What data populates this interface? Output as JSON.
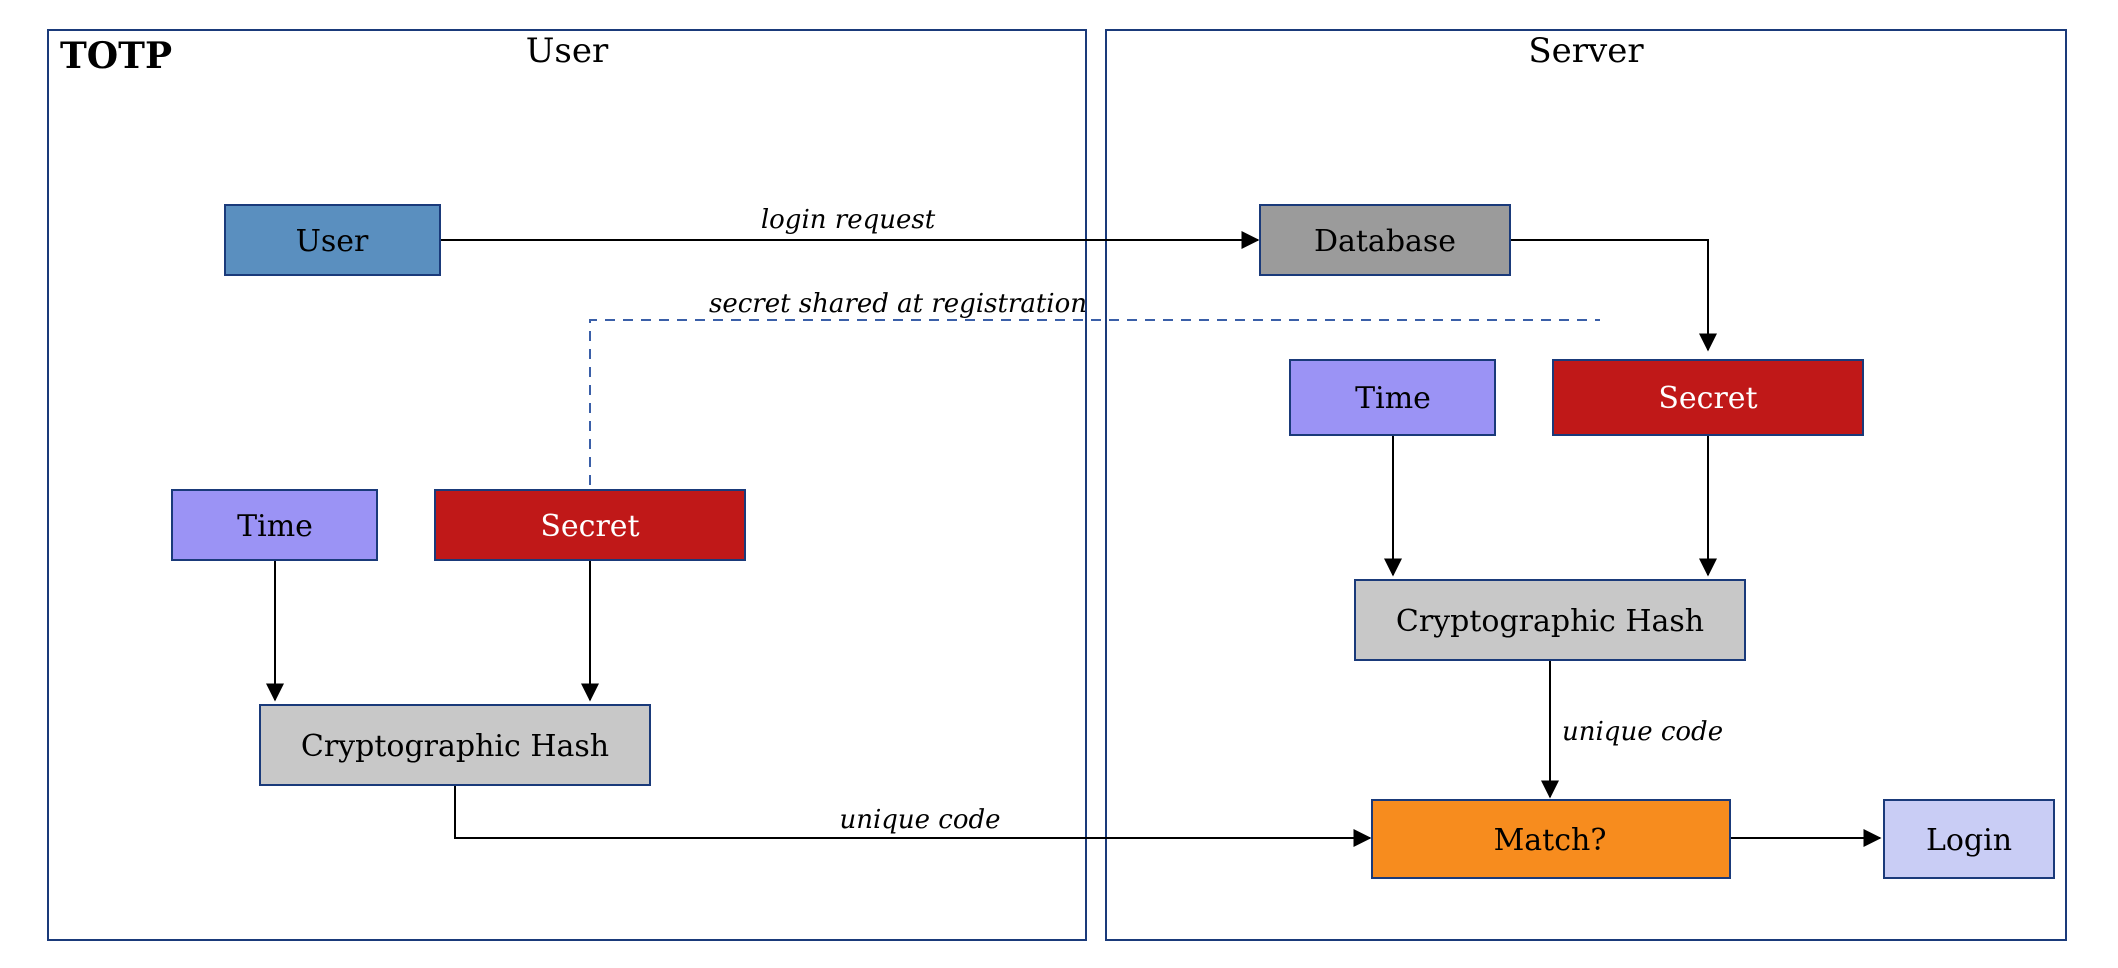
{
  "diagram": {
    "title": "TOTP",
    "panels": {
      "user": "User",
      "server": "Server"
    },
    "nodes": {
      "user": "User",
      "database": "Database",
      "time_u": "Time",
      "secret_u": "Secret",
      "time_s": "Time",
      "secret_s": "Secret",
      "hash_u": "Cryptographic Hash",
      "hash_s": "Cryptographic Hash",
      "match": "Match?",
      "login": "Login"
    },
    "edges": {
      "login_request": "login request",
      "secret_shared": "secret shared at registration",
      "unique_code_u": "unique code",
      "unique_code_s": "unique code"
    },
    "colors": {
      "user": "#5a8fbf",
      "database": "#9b9b9b",
      "time": "#9b93f5",
      "secret": "#c01818",
      "hash": "#c8c8c8",
      "match": "#f78c1e",
      "login": "#c9cdf5"
    }
  }
}
